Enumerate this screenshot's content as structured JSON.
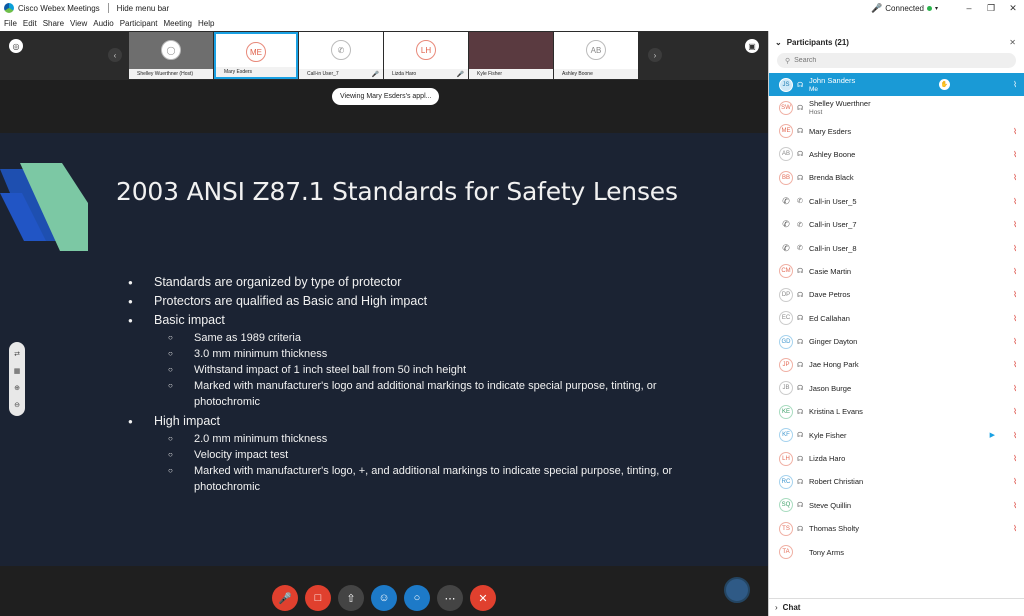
{
  "window": {
    "app_title": "Cisco Webex Meetings",
    "hide_menu": "Hide menu bar",
    "connection": "Connected"
  },
  "menu": [
    "File",
    "Edit",
    "Share",
    "View",
    "Audio",
    "Participant",
    "Meeting",
    "Help"
  ],
  "filmstrip": [
    {
      "name": "Shelley Wuerthner (Host)",
      "initials": "",
      "style": "grey"
    },
    {
      "name": "Mary Esders",
      "initials": "ME",
      "style": "selected"
    },
    {
      "name": "Call-in User_7",
      "initials": "",
      "style": "phone"
    },
    {
      "name": "Lizda Haro",
      "initials": "LH",
      "style": "normal"
    },
    {
      "name": "Kyle Fisher",
      "initials": "",
      "style": "photo"
    },
    {
      "name": "Ashley Boone",
      "initials": "AB",
      "style": "normal"
    }
  ],
  "viewing": "Viewing Mary Esders's appl...",
  "slide": {
    "title": "2003 ANSI Z87.1 Standards for Safety Lenses",
    "bullets": [
      "Standards are organized by type of protector",
      "Protectors are qualified as Basic and High impact",
      "Basic impact",
      "Same as 1989 criteria",
      "3.0 mm minimum thickness",
      "Withstand impact of 1 inch steel ball from 50 inch height",
      "Marked with manufacturer's logo and additional markings to indicate special purpose, tinting, or photochromic",
      "High impact",
      "2.0 mm minimum thickness",
      "Velocity impact test",
      "Marked with manufacturer's logo, +, and additional markings to indicate special purpose, tinting, or photochromic"
    ]
  },
  "panel": {
    "title": "Participants (21)",
    "search_placeholder": "Search",
    "chat": "Chat"
  },
  "participants": [
    {
      "initials": "JS",
      "name": "John Sanders",
      "sub": "Me",
      "color": "blue"
    },
    {
      "initials": "SW",
      "name": "Shelley Wuerthner",
      "sub": "Host",
      "color": "red"
    },
    {
      "initials": "ME",
      "name": "Mary Esders",
      "sub": "",
      "color": "red"
    },
    {
      "initials": "AB",
      "name": "Ashley Boone",
      "sub": "",
      "color": "gray"
    },
    {
      "initials": "BB",
      "name": "Brenda Black",
      "sub": "",
      "color": "red"
    },
    {
      "initials": "",
      "name": "Call-in User_5",
      "sub": "",
      "color": "phone"
    },
    {
      "initials": "",
      "name": "Call-in User_7",
      "sub": "",
      "color": "phone"
    },
    {
      "initials": "",
      "name": "Call-in User_8",
      "sub": "",
      "color": "phone"
    },
    {
      "initials": "CM",
      "name": "Casie Martin",
      "sub": "",
      "color": "red"
    },
    {
      "initials": "DP",
      "name": "Dave Petros",
      "sub": "",
      "color": "gray"
    },
    {
      "initials": "EC",
      "name": "Ed Callahan",
      "sub": "",
      "color": "gray"
    },
    {
      "initials": "GD",
      "name": "Ginger Dayton",
      "sub": "",
      "color": "blue"
    },
    {
      "initials": "JP",
      "name": "Jae Hong Park",
      "sub": "",
      "color": "red"
    },
    {
      "initials": "JB",
      "name": "Jason Burge",
      "sub": "",
      "color": "gray"
    },
    {
      "initials": "KE",
      "name": "Kristina L Evans",
      "sub": "",
      "color": "green"
    },
    {
      "initials": "KF",
      "name": "Kyle Fisher",
      "sub": "",
      "color": "blue"
    },
    {
      "initials": "LH",
      "name": "Lizda Haro",
      "sub": "",
      "color": "red"
    },
    {
      "initials": "RC",
      "name": "Robert Christian",
      "sub": "",
      "color": "blue"
    },
    {
      "initials": "SQ",
      "name": "Steve Quillin",
      "sub": "",
      "color": "green"
    },
    {
      "initials": "TS",
      "name": "Thomas Sholty",
      "sub": "",
      "color": "red"
    },
    {
      "initials": "TA",
      "name": "Tony Arms",
      "sub": "",
      "color": "red"
    }
  ],
  "colors": {
    "accent": "#1a9ad6",
    "end_call": "#e0402e",
    "slide_bg": "#1b2333"
  }
}
